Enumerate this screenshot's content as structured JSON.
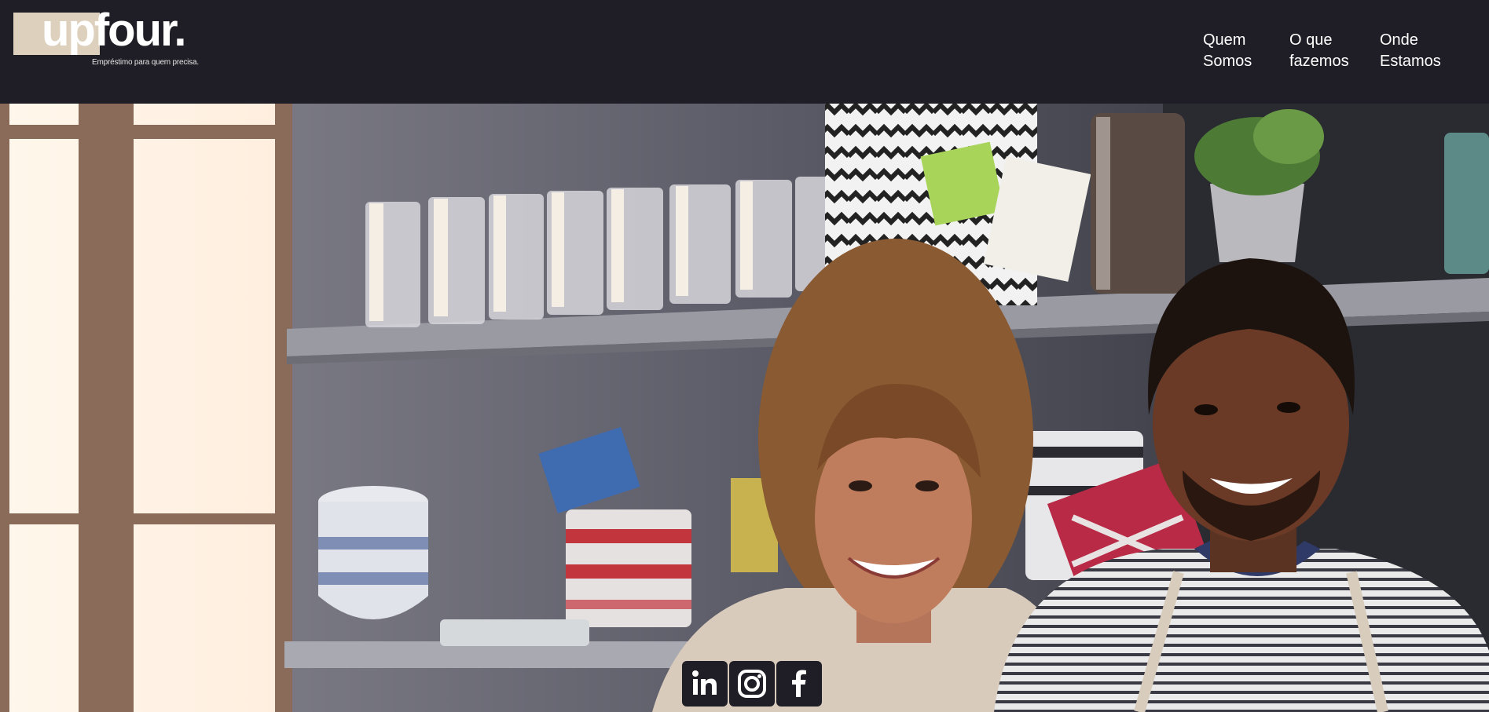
{
  "header": {
    "logo": {
      "wordmark": "upfour.",
      "tagline": "Empréstimo para quem precisa."
    },
    "nav": [
      {
        "line1": "Quem",
        "line2": "Somos"
      },
      {
        "line1": "O que",
        "line2": "fazemos"
      },
      {
        "line1": "Onde",
        "line2": "Estamos"
      }
    ]
  },
  "hero": {
    "image": "photo-two-smiling-shop-owners-kitchenware-shelves"
  },
  "social": [
    {
      "network": "LinkedIn",
      "icon": "linkedin-icon"
    },
    {
      "network": "Instagram",
      "icon": "instagram-icon"
    },
    {
      "network": "Facebook",
      "icon": "facebook-icon"
    }
  ],
  "colors": {
    "header_background": "#1f1e26",
    "logo_accent": "#ddd0bd",
    "text": "#ffffff"
  }
}
